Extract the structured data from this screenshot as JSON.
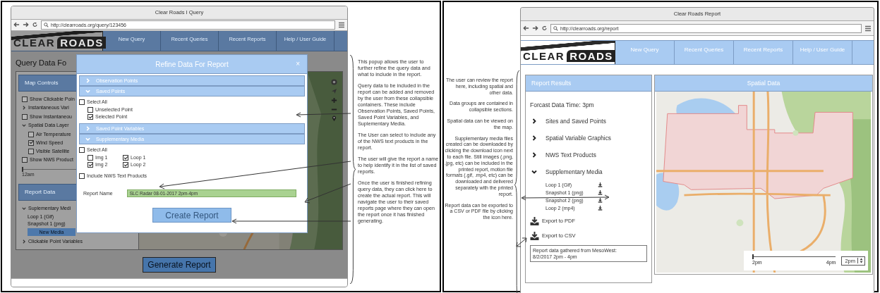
{
  "query_window": {
    "title": "Clear Roads I Query",
    "url": "http://clearroads.org/query/123456",
    "logo": [
      "CLEAR",
      "ROADS"
    ],
    "nav": [
      {
        "label": "New Query"
      },
      {
        "label": "Recent Queries"
      },
      {
        "label": "Recent Reports"
      },
      {
        "label": "Help / User Guide"
      }
    ],
    "page_heading": "Query Data Fo",
    "map_controls": {
      "title": "Map Controls",
      "items": [
        {
          "kind": "checkbox",
          "label": "Show Clickable Poin",
          "checked": false
        },
        {
          "kind": "group",
          "label": "Instantaneous Vari",
          "expanded": false
        },
        {
          "kind": "checkbox",
          "label": "Show Instantaneou",
          "checked": false
        },
        {
          "kind": "group",
          "label": "Spatial Data Layer",
          "expanded": true,
          "children": [
            {
              "kind": "checkbox",
              "label": "Air Temperature",
              "checked": false
            },
            {
              "kind": "checkbox",
              "label": "Wind Speed",
              "checked": true
            },
            {
              "kind": "checkbox",
              "label": "Visible Satellite",
              "checked": false
            }
          ]
        },
        {
          "kind": "checkbox",
          "label": "Show NWS Product",
          "checked": false
        }
      ],
      "slider": {
        "level": 0,
        "label": "12am"
      }
    },
    "report_data": {
      "title": "Report Data",
      "items": [
        {
          "kind": "group",
          "label": "Suplementary Medi",
          "expanded": true,
          "children": [
            {
              "kind": "text",
              "label": "Loop 1 (Gif)"
            },
            {
              "kind": "text",
              "label": "Snapshot 1 (png)"
            },
            {
              "kind": "button",
              "label": "New Media"
            }
          ]
        },
        {
          "kind": "group",
          "label": "Clickable Point Variables",
          "expanded": false
        }
      ]
    },
    "generate_button": "Generate Report",
    "modal": {
      "title": "Refine Data For Report",
      "close": "×",
      "sections": [
        {
          "label": "Observation Points",
          "expanded": false
        },
        {
          "label": "Saved Points",
          "expanded": true,
          "kind": "list",
          "options": [
            {
              "label": "Select All",
              "checked": false,
              "children": [
                {
                  "label": "Unselected Point",
                  "checked": false
                },
                {
                  "label": "Selected Point",
                  "checked": true
                }
              ]
            }
          ]
        },
        {
          "label": "Saved Point Variables",
          "expanded": false
        },
        {
          "label": "Supplementary Media",
          "expanded": true,
          "kind": "grid",
          "options": [
            {
              "label": "Select All",
              "checked": false,
              "children": [
                {
                  "label": "Img 1",
                  "checked": false
                },
                {
                  "label": "Loop 1",
                  "checked": true
                },
                {
                  "label": "Img 2",
                  "checked": true
                },
                {
                  "label": "Loop 2",
                  "checked": true
                }
              ]
            }
          ]
        }
      ],
      "include_nws": {
        "label": "Include NWS Text Products",
        "checked": false
      },
      "report_name": {
        "label": "Report Name",
        "value": "SLC Radar 08-01-2017 2pm-4pm"
      },
      "create_button": "Create Report"
    }
  },
  "query_notes": [
    "This popup allows the user to further refine the query data and what to include in the report.",
    "Query data to be included in the report can be added and removed by the user from these collapsible containers. These include Observation Points, Saved Points, Saved Point Variables, and Suplementary Media.",
    "The User can select to include any of the NWS text products in the report.",
    "The user will give the report a name to help identify it in the list of saved reports.",
    "Once the user is finished refining query data, they can click here to create the actual report. This will navigate the user to their saved reports page where they can open the report once it has finished generating."
  ],
  "report_notes": [
    "The user can review the report here, including spatial and other data.",
    "Data groups are contained in collapsible sections.",
    "Spatial data can be viewed on the map.",
    "Supplementary media files created can be downloaded by clicking the download icon next to each file. Still images (.png, .jpg, etc) can be included in the printed report, motion file formats (.gif, .mp4, etc) can be downloaded and delivered separately with the printed report.",
    "Report data can be exported to a CSV or PDF file by clicking the icon here."
  ],
  "report_window": {
    "title": "Clear Roads Report",
    "url": "http://clearroads.org/report",
    "logo": [
      "CLEAR",
      "ROADS"
    ],
    "nav": [
      {
        "label": "New Query"
      },
      {
        "label": "Recent Queries"
      },
      {
        "label": "Recent Reports"
      },
      {
        "label": "Help / User Guide"
      }
    ],
    "results": {
      "title": "Report Results",
      "forecast": "Forcast Data Time: 3pm",
      "sections": [
        {
          "label": "Sites and Saved Points",
          "expanded": false
        },
        {
          "label": "Spatial Variable Graphics",
          "expanded": false
        },
        {
          "label": "NWS Text Products",
          "expanded": false
        },
        {
          "label": "Supplementary Media",
          "expanded": true,
          "files": [
            "Loop 1 (Gif)",
            "Snapshot 1 (png)",
            "Snapshot 2 (png)",
            "Loop 2 (mp4)"
          ]
        }
      ],
      "exports": [
        "Export to PDF",
        "Export to CSV"
      ],
      "footer": "Report data gathered from MesoWest:\n8/2/2017 2pm - 4pm"
    },
    "spatial": {
      "title": "Spatial Data",
      "slider": {
        "level": 0,
        "min_label": "2pm",
        "max_label": "4pm",
        "value": "2pm"
      }
    }
  }
}
